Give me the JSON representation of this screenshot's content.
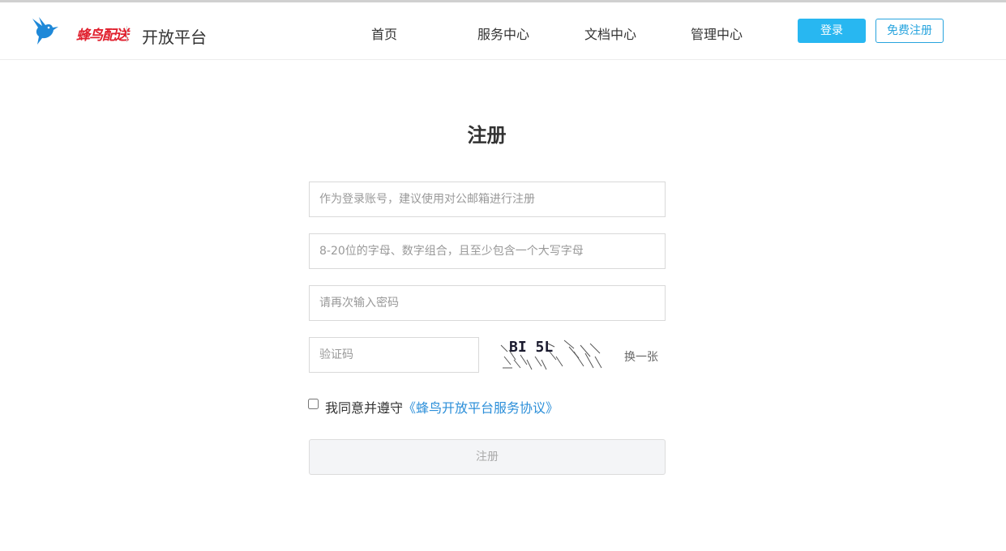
{
  "header": {
    "logo_text": "蜂鸟配送",
    "platform_title": "开放平台",
    "nav": {
      "home": "首页",
      "service": "服务中心",
      "docs": "文档中心",
      "admin": "管理中心"
    },
    "login_label": "登录",
    "register_label": "免费注册"
  },
  "form": {
    "title": "注册",
    "account_placeholder": "作为登录账号，建议使用对公邮箱进行注册",
    "password_placeholder": "8-20位的字母、数字组合，且至少包含一个大写字母",
    "confirm_placeholder": "请再次输入密码",
    "captcha_placeholder": "验证码",
    "captcha_text": "BI 5L",
    "captcha_refresh": "换一张",
    "agree_text": "我同意并遵守",
    "agree_link": "《蜂鸟开放平台服务协议》",
    "agree_checked": false,
    "submit_label": "注册"
  },
  "colors": {
    "primary": "#28b7f1",
    "link": "#2c8fd9",
    "logo_red": "#e01f2d",
    "logo_blue": "#1e88d8"
  },
  "icons": {
    "logo": "hummingbird-icon"
  }
}
